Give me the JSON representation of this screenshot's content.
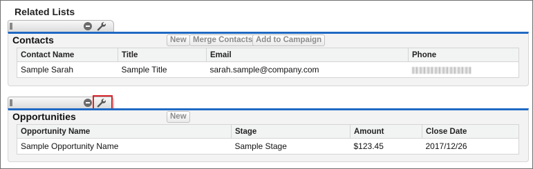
{
  "page": {
    "title": "Related Lists"
  },
  "contacts": {
    "title": "Contacts",
    "buttons": {
      "new": "New",
      "merge": "Merge Contacts",
      "add_campaign": "Add to Campaign"
    },
    "columns": [
      "Contact Name",
      "Title",
      "Email",
      "Phone"
    ],
    "rows": [
      {
        "name": "Sample Sarah",
        "title": "Sample Title",
        "email": "sarah.sample@company.com",
        "phone": ""
      }
    ]
  },
  "opportunities": {
    "title": "Opportunities",
    "buttons": {
      "new": "New"
    },
    "columns": [
      "Opportunity Name",
      "Stage",
      "Amount",
      "Close Date"
    ],
    "rows": [
      {
        "name": "Sample Opportunity Name",
        "stage": "Sample Stage",
        "amount": "$123.45",
        "close_date": "2017/12/26"
      }
    ]
  },
  "icons": {
    "toolbar_grip": "grip-icon",
    "collapse": "minus-circle-icon",
    "properties": "wrench-icon"
  },
  "colors": {
    "section_accent": "#1f69c3",
    "highlight_box": "#d8232a"
  }
}
